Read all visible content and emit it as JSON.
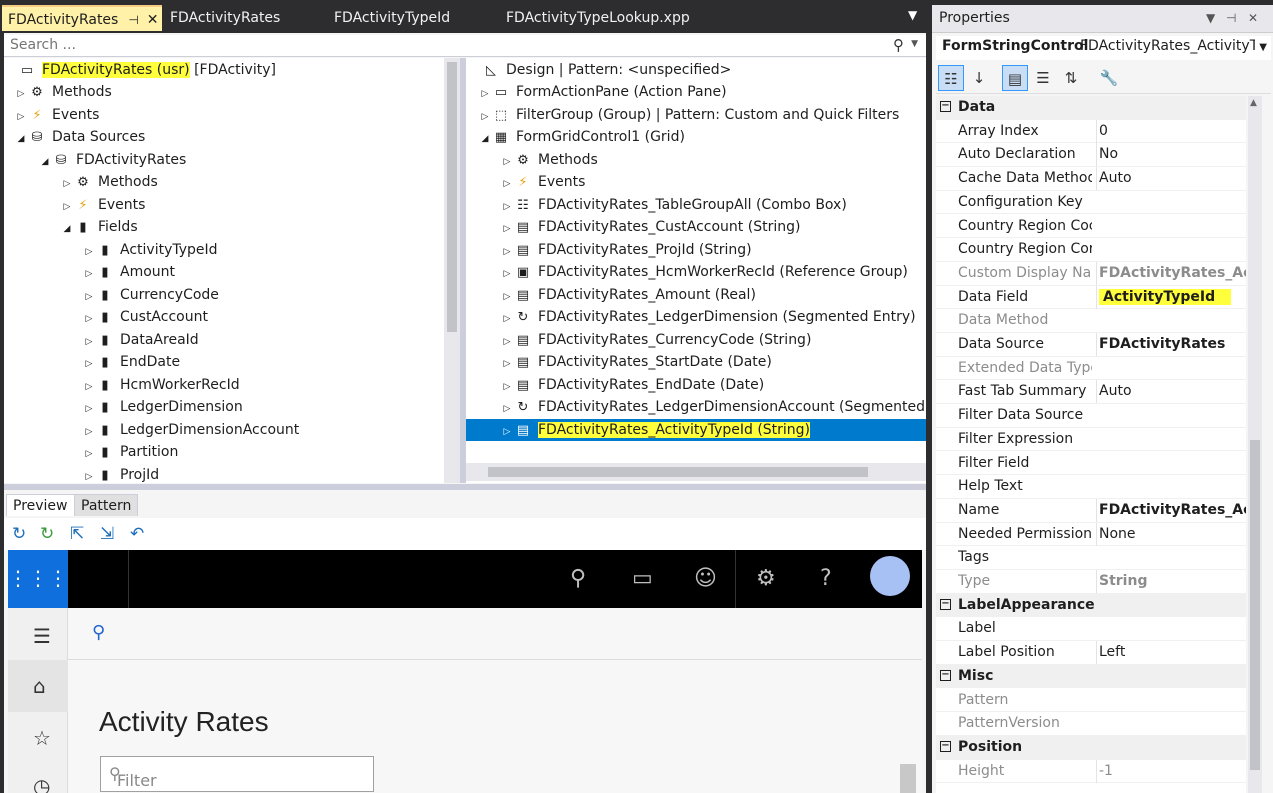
{
  "tabs": [
    {
      "label": "FDActivityRates",
      "active": true
    },
    {
      "label": "FDActivityRates",
      "active": false
    },
    {
      "label": "FDActivityTypeId",
      "active": false
    },
    {
      "label": "FDActivityTypeLookup.xpp",
      "active": false
    }
  ],
  "search": {
    "placeholder": "Search ..."
  },
  "left_tree": {
    "root_name": "FDActivityRates (usr)",
    "root_suffix": " [FDActivity]",
    "items": [
      {
        "label": "Methods",
        "icon": "methods-icon"
      },
      {
        "label": "Events",
        "icon": "lightning-icon"
      },
      {
        "label": "Data Sources",
        "icon": "database-icon"
      },
      {
        "label": "FDActivityRates",
        "icon": "database-icon"
      },
      {
        "label": "Methods",
        "icon": "methods-icon"
      },
      {
        "label": "Events",
        "icon": "lightning-icon"
      },
      {
        "label": "Fields",
        "icon": "field-icon"
      },
      {
        "label": "ActivityTypeId",
        "icon": "field-icon"
      },
      {
        "label": "Amount",
        "icon": "field-icon"
      },
      {
        "label": "CurrencyCode",
        "icon": "field-icon"
      },
      {
        "label": "CustAccount",
        "icon": "field-icon"
      },
      {
        "label": "DataAreaId",
        "icon": "field-icon"
      },
      {
        "label": "EndDate",
        "icon": "field-icon"
      },
      {
        "label": "HcmWorkerRecId",
        "icon": "field-icon"
      },
      {
        "label": "LedgerDimension",
        "icon": "field-icon"
      },
      {
        "label": "LedgerDimensionAccount",
        "icon": "field-icon"
      },
      {
        "label": "Partition",
        "icon": "field-icon"
      },
      {
        "label": "ProjId",
        "icon": "field-icon"
      }
    ]
  },
  "right_tree": {
    "design": "Design | Pattern: <unspecified>",
    "items": [
      {
        "label": "FormActionPane (Action Pane)"
      },
      {
        "label": "FilterGroup (Group) | Pattern: Custom and Quick Filters"
      },
      {
        "label": "FormGridControl1 (Grid)"
      },
      {
        "label": "Methods"
      },
      {
        "label": "Events"
      },
      {
        "label": "FDActivityRates_TableGroupAll (Combo Box)"
      },
      {
        "label": "FDActivityRates_CustAccount (String)"
      },
      {
        "label": "FDActivityRates_ProjId (String)"
      },
      {
        "label": "FDActivityRates_HcmWorkerRecId (Reference Group)"
      },
      {
        "label": "FDActivityRates_Amount (Real)"
      },
      {
        "label": "FDActivityRates_LedgerDimension (Segmented Entry)"
      },
      {
        "label": "FDActivityRates_CurrencyCode (String)"
      },
      {
        "label": "FDActivityRates_StartDate (Date)"
      },
      {
        "label": "FDActivityRates_EndDate (Date)"
      },
      {
        "label": "FDActivityRates_LedgerDimensionAccount (Segmented"
      },
      {
        "label": "FDActivityRates_ActivityTypeId (String)"
      }
    ]
  },
  "bottom_tabs": {
    "preview": "Preview",
    "pattern": "Pattern"
  },
  "preview": {
    "title": "Activity Rates",
    "filter_placeholder": "Filter"
  },
  "properties": {
    "title": "Properties",
    "object_type": "FormStringControl",
    "object_name": "FDActivityRates_ActivityTy",
    "rows": [
      {
        "cat": "Data"
      },
      {
        "name": "Array Index",
        "value": "0"
      },
      {
        "name": "Auto Declaration",
        "value": "No"
      },
      {
        "name": "Cache Data Method",
        "value": "Auto"
      },
      {
        "name": "Configuration Key",
        "value": ""
      },
      {
        "name": "Country Region Coc",
        "value": ""
      },
      {
        "name": "Country Region Cor",
        "value": ""
      },
      {
        "name": "Custom Display Nar",
        "value": "FDActivityRates_Acti"
      },
      {
        "name": "Data Field",
        "value": "ActivityTypeId"
      },
      {
        "name": "Data Method",
        "value": ""
      },
      {
        "name": "Data Source",
        "value": "FDActivityRates"
      },
      {
        "name": "Extended Data Type",
        "value": ""
      },
      {
        "name": "Fast Tab Summary",
        "value": "Auto"
      },
      {
        "name": "Filter Data Source",
        "value": ""
      },
      {
        "name": "Filter Expression",
        "value": ""
      },
      {
        "name": "Filter Field",
        "value": ""
      },
      {
        "name": "Help Text",
        "value": ""
      },
      {
        "name": "Name",
        "value": "FDActivityRates_Acti"
      },
      {
        "name": "Needed Permission",
        "value": "None"
      },
      {
        "name": "Tags",
        "value": ""
      },
      {
        "name": "Type",
        "value": "String"
      },
      {
        "cat": "LabelAppearance"
      },
      {
        "name": "Label",
        "value": ""
      },
      {
        "name": "Label Position",
        "value": "Left"
      },
      {
        "cat": "Misc"
      },
      {
        "name": "Pattern",
        "value": ""
      },
      {
        "name": "PatternVersion",
        "value": ""
      },
      {
        "cat": "Position"
      },
      {
        "name": "Height",
        "value": "-1"
      }
    ]
  },
  "colors": {
    "accent": "#007acc",
    "highlight": "#ffff3c",
    "waffle": "#0f6fdd"
  }
}
